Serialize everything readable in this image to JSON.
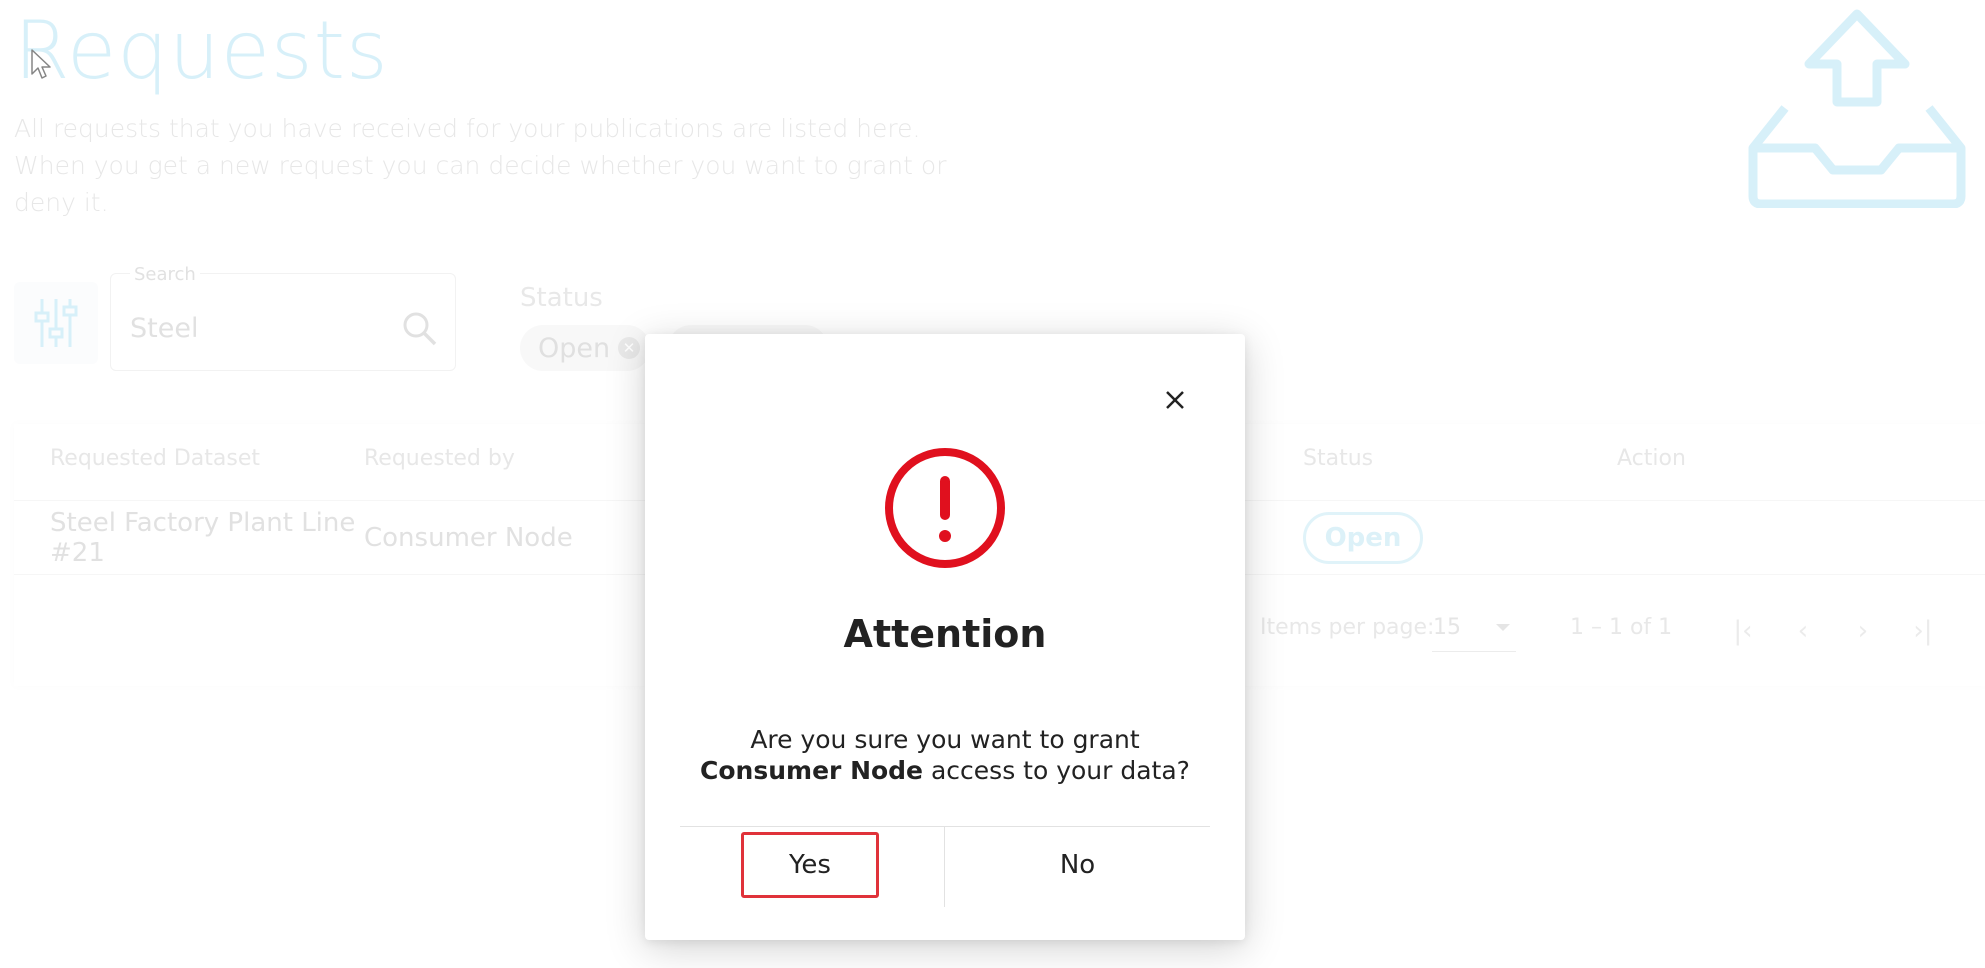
{
  "header": {
    "title": "Requests",
    "description": "All requests that you have received for your publications are listed here. When you get a new request you can decide whether you want to grant or deny it.",
    "icon": "outbox-upload-icon"
  },
  "filters": {
    "filter_icon": "sliders-icon",
    "search_label": "Search",
    "search_value": "Steel",
    "status_label": "Status",
    "chips": [
      {
        "label": "Open"
      }
    ]
  },
  "table": {
    "columns": [
      "Requested Dataset",
      "Requested by",
      "Status",
      "Action"
    ],
    "rows": [
      {
        "dataset_line1": "Steel Factory Plant Line",
        "dataset_line2": "#21",
        "requested_by": "Consumer Node",
        "status": "Open"
      }
    ],
    "pager": {
      "items_per_page_label": "Items per page:",
      "items_per_page": "15",
      "range": "1 – 1 of 1"
    }
  },
  "modal": {
    "icon": "alert-circle-icon",
    "title": "Attention",
    "text_line1": "Are you sure you want to grant",
    "text_bold": "Consumer Node",
    "text_rest": " access to your data?",
    "yes_label": "Yes",
    "no_label": "No"
  },
  "colors": {
    "accent": "#b7e3f4",
    "alert": "#e0101e",
    "highlight_border": "#e0323a"
  }
}
